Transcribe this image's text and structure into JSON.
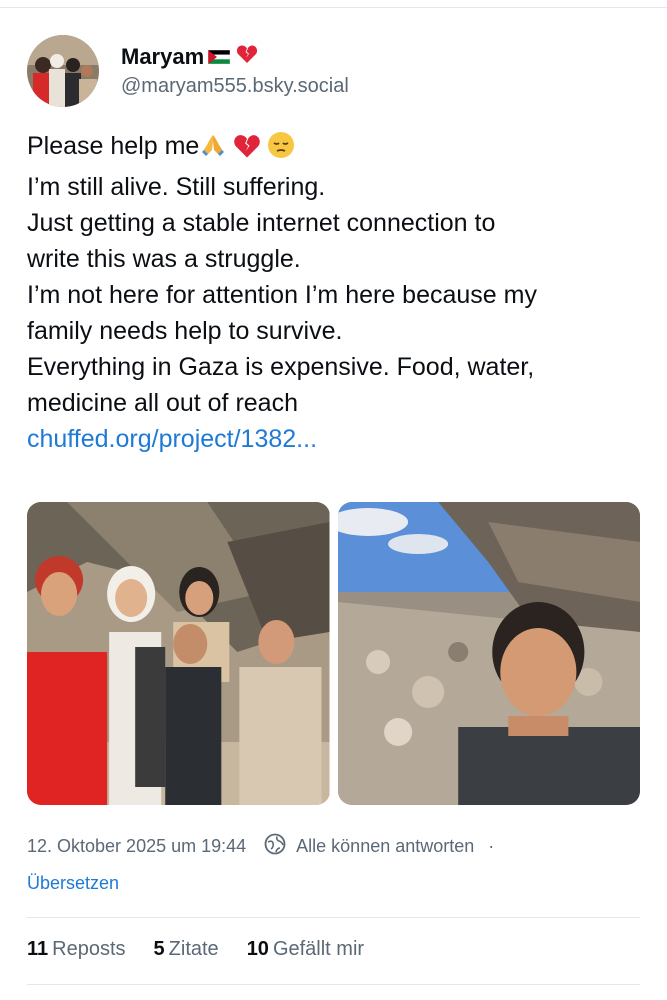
{
  "author": {
    "display_name": "Maryam",
    "handle": "@maryam555.bsky.social"
  },
  "post": {
    "lines": [
      "Please help me",
      "I’m still alive. Still suffering.",
      "Just getting a stable internet connection to",
      "write this was a struggle.",
      "I’m not here for attention I’m here because my",
      "family needs help to survive.",
      "Everything in Gaza is expensive. Food, water,",
      "medicine all out of reach"
    ],
    "link_text": "chuffed.org/project/1382..."
  },
  "meta": {
    "timestamp": "12. Oktober 2025 um 19:44",
    "reply_setting": "Alle können antworten",
    "separator": "·",
    "translate_label": "Übersetzen"
  },
  "stats": {
    "reposts_count": "11",
    "reposts_label": "Reposts",
    "quotes_count": "5",
    "quotes_label": "Zitate",
    "likes_count": "10",
    "likes_label": "Gefällt mir"
  },
  "colors": {
    "link": "#1f7ad6",
    "muted": "#5b6875",
    "text": "#0b0f14"
  }
}
